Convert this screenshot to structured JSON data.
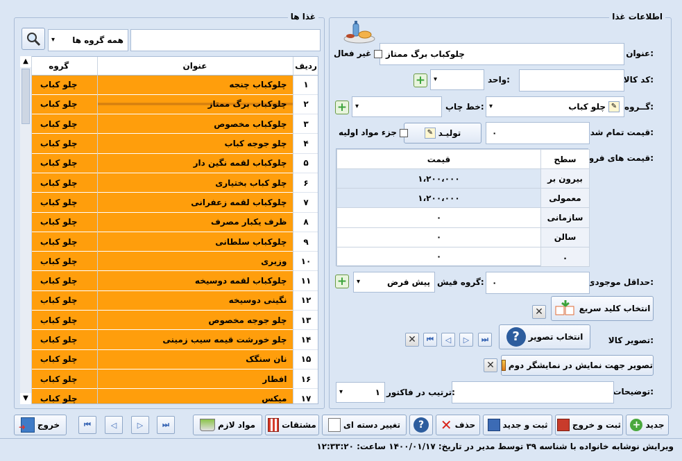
{
  "food_info": {
    "title": "اطلاعات غذا",
    "name_label": "عنوان:",
    "name_value": "چلوکباب برگ ممتاز",
    "inactive_label": "غیر فعال",
    "code_label": "کد کالا:",
    "code_value": "",
    "unit_label": "واحد:",
    "unit_value": "",
    "group_label": "گــروه:",
    "group_value": "چلو کباب",
    "print_line_label": "خط چاپ:",
    "print_line_value": "",
    "cost_label": "قیمت تمام شده:",
    "cost_value": "۰",
    "produce_button": "تولیـد",
    "raw_material_label": "جزء مواد اولیه",
    "prices_label": "قیمت های فروش:",
    "price_table": {
      "headers": [
        "سطح",
        "قیمت"
      ],
      "rows": [
        {
          "level": "بیرون بر",
          "price": "۱،۲۰۰،۰۰۰"
        },
        {
          "level": "معمولی",
          "price": "۱،۲۰۰،۰۰۰"
        },
        {
          "level": "سازمانی",
          "price": "۰"
        },
        {
          "level": "سالن",
          "price": "۰"
        },
        {
          "level": ".",
          "price": "۰"
        }
      ]
    },
    "min_stock_label": "حداقل موجودی:",
    "min_stock_value": "۰",
    "receipt_group_label": "گروه فیش:",
    "receipt_group_value": "پیش فرض",
    "quick_key_button": "انتخاب کلید سریع",
    "image_label": "تصویر کالا:",
    "select_image_button": "انتخاب تصویر",
    "second_display_button": "تصویر جهت نمایش در نمایشگر دوم",
    "description_label": "توضیحات:",
    "description_value": "",
    "invoice_order_label": "ترتیب در فاکتور:",
    "invoice_order_value": "۱"
  },
  "foods": {
    "title": "غذا ها",
    "search_value": "",
    "group_filter": "همه گروه ها",
    "columns": [
      "ردیف",
      "عنوان",
      "گروه"
    ],
    "rows": [
      {
        "n": "۱",
        "title": "چلوکباب چنجه",
        "group": "چلو کباب"
      },
      {
        "n": "۲",
        "title": "چلوکباب برگ ممتاز",
        "group": "چلو کباب"
      },
      {
        "n": "۳",
        "title": "چلوکباب مخصوص",
        "group": "چلو کباب"
      },
      {
        "n": "۴",
        "title": "چلو جوجه کباب",
        "group": "چلو کباب"
      },
      {
        "n": "۵",
        "title": "چلوکباب لقمه نگین دار",
        "group": "چلو کباب"
      },
      {
        "n": "۶",
        "title": "چلو کباب بختیاری",
        "group": "چلو کباب"
      },
      {
        "n": "۷",
        "title": "چلوکباب لقمه زعفرانی",
        "group": "چلو کباب"
      },
      {
        "n": "۸",
        "title": "ظرف یکبار مصرف",
        "group": "چلو کباب"
      },
      {
        "n": "۹",
        "title": "چلوکباب سلطانی",
        "group": "چلو کباب"
      },
      {
        "n": "۱۰",
        "title": "وزیری",
        "group": "چلو کباب"
      },
      {
        "n": "۱۱",
        "title": "چلوکباب لقمه دوسیخه",
        "group": "چلو کباب"
      },
      {
        "n": "۱۲",
        "title": "نگینی دوسیخه",
        "group": "چلو کباب"
      },
      {
        "n": "۱۳",
        "title": "چلو جوجه مخصوص",
        "group": "چلو کباب"
      },
      {
        "n": "۱۴",
        "title": "چلو خورشت قیمه سیب زمینی",
        "group": "چلو کباب"
      },
      {
        "n": "۱۵",
        "title": "نان سنگک",
        "group": "چلو کباب"
      },
      {
        "n": "۱۶",
        "title": "افطار",
        "group": "چلو کباب"
      },
      {
        "n": "۱۷",
        "title": "میکس",
        "group": "چلو کباب"
      }
    ]
  },
  "toolbar": {
    "new": "جدید",
    "save_exit": "ثبت و خروج",
    "save_new": "ثبت و جدید",
    "delete": "حذف",
    "batch_change": "تغییر دسته ای",
    "derivatives": "مشتقات",
    "materials": "مواد لازم",
    "exit": "خروج"
  },
  "status": "ویرایش نوشابه خانواده با شناسه ۳۹ توسط مدیر در تاریخ: ۱۴۰۰/۰۱/۱۷ ساعت: ۱۲:۳۳:۲۰"
}
